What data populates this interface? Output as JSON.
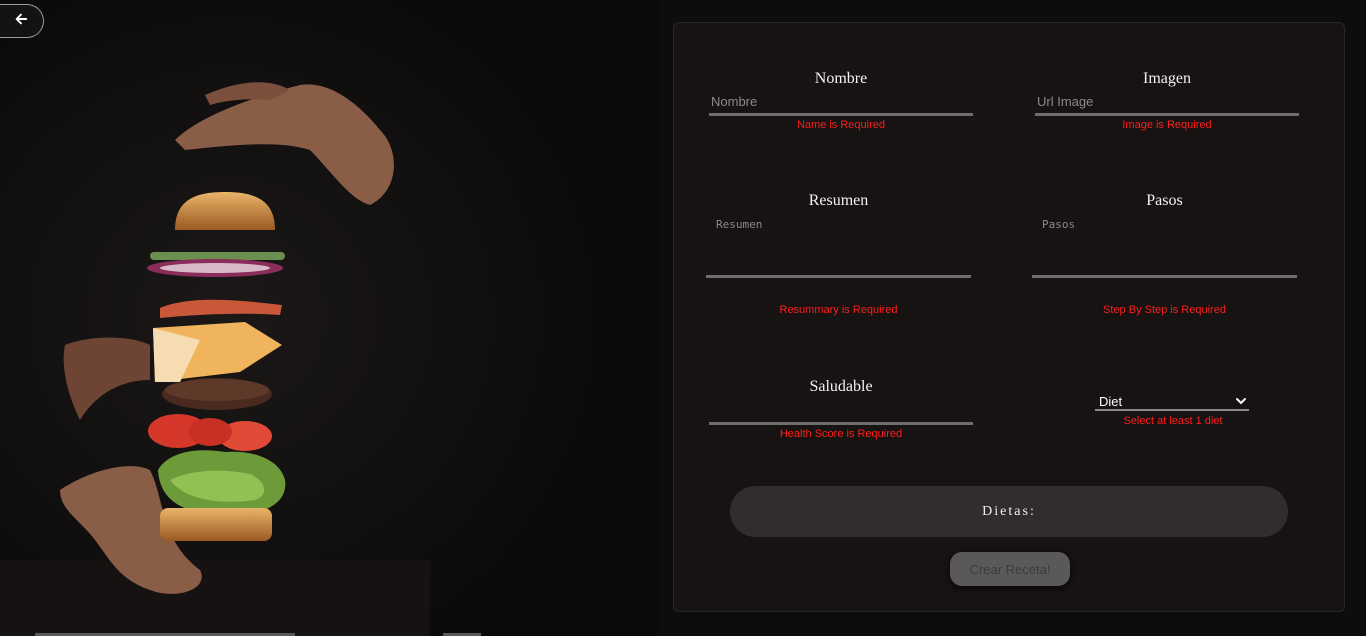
{
  "nav": {
    "back_icon": "arrow-left-icon"
  },
  "form": {
    "nombre": {
      "label": "Nombre",
      "placeholder": "Nombre",
      "error": "Name is Required"
    },
    "imagen": {
      "label": "Imagen",
      "placeholder": "Url Image",
      "error": "Image is Required"
    },
    "resumen": {
      "label": "Resumen",
      "placeholder": "Resumen",
      "error": "Resummary is Required"
    },
    "pasos": {
      "label": "Pasos",
      "placeholder": "Pasos",
      "error": "Step By Step is Required"
    },
    "saludable": {
      "label": "Saludable",
      "placeholder": "",
      "error": "Health Score is Required"
    },
    "diet_select": {
      "value": "Diet",
      "error": "Select at least 1 diet",
      "icon": "chevron-down-icon"
    },
    "dietas": {
      "title": "Dietas:"
    },
    "submit_label": "Crear Receta!"
  },
  "colors": {
    "error": "#ff1e1e",
    "card": "#161312",
    "dietas_bg": "#322d2c",
    "button_disabled": "#5b5958"
  }
}
